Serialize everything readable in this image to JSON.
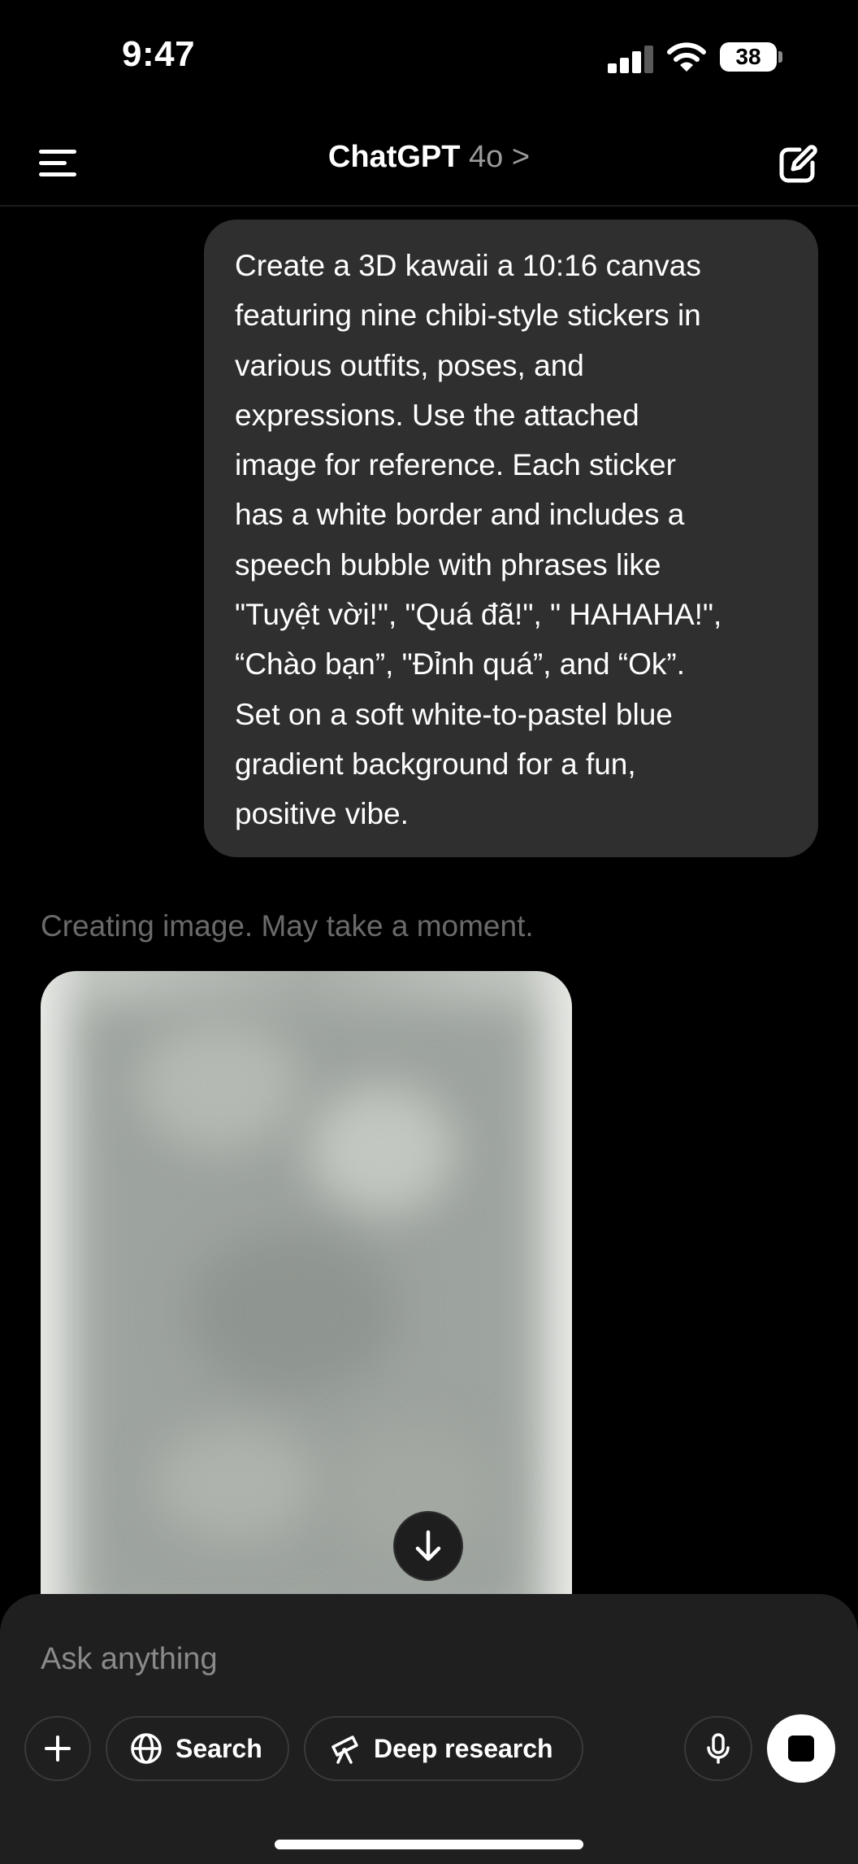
{
  "status_bar": {
    "time": "9:47",
    "battery": "38",
    "icons": [
      "signal-icon",
      "wifi-icon",
      "battery-icon"
    ]
  },
  "header": {
    "title": "ChatGPT",
    "model": "4o",
    "chevron": ">",
    "icons": [
      "menu-icon",
      "new-chat-icon"
    ]
  },
  "conversation": {
    "user_message_lines": [
      "Create a 3D kawaii a 10:16 canvas",
      "featuring nine chibi-style stickers in",
      "various outfits, poses, and",
      "expressions. Use the attached",
      "image for reference. Each sticker",
      "has a white border and includes a",
      "speech bubble with phrases like",
      "\"Tuyệt vời!\", \"Quá đã!\", \" HAHAHA!\",",
      "“Chào bạn”, \"Đỉnh quá”, and “Ok”.",
      "Set on a soft white-to-pastel blue",
      "gradient background for a fun,",
      "positive vibe."
    ],
    "assistant_status": "Creating image. May take a moment."
  },
  "composer": {
    "placeholder": "Ask anything",
    "search_label": "Search",
    "deep_research_label": "Deep research",
    "icons": [
      "plus-icon",
      "globe-icon",
      "telescope-icon",
      "mic-icon",
      "stop-icon"
    ]
  },
  "colors": {
    "background": "#000000",
    "user_bubble": "#2f2f2f",
    "composer": "#1f1f1f",
    "muted_text": "#6a6a6a"
  }
}
